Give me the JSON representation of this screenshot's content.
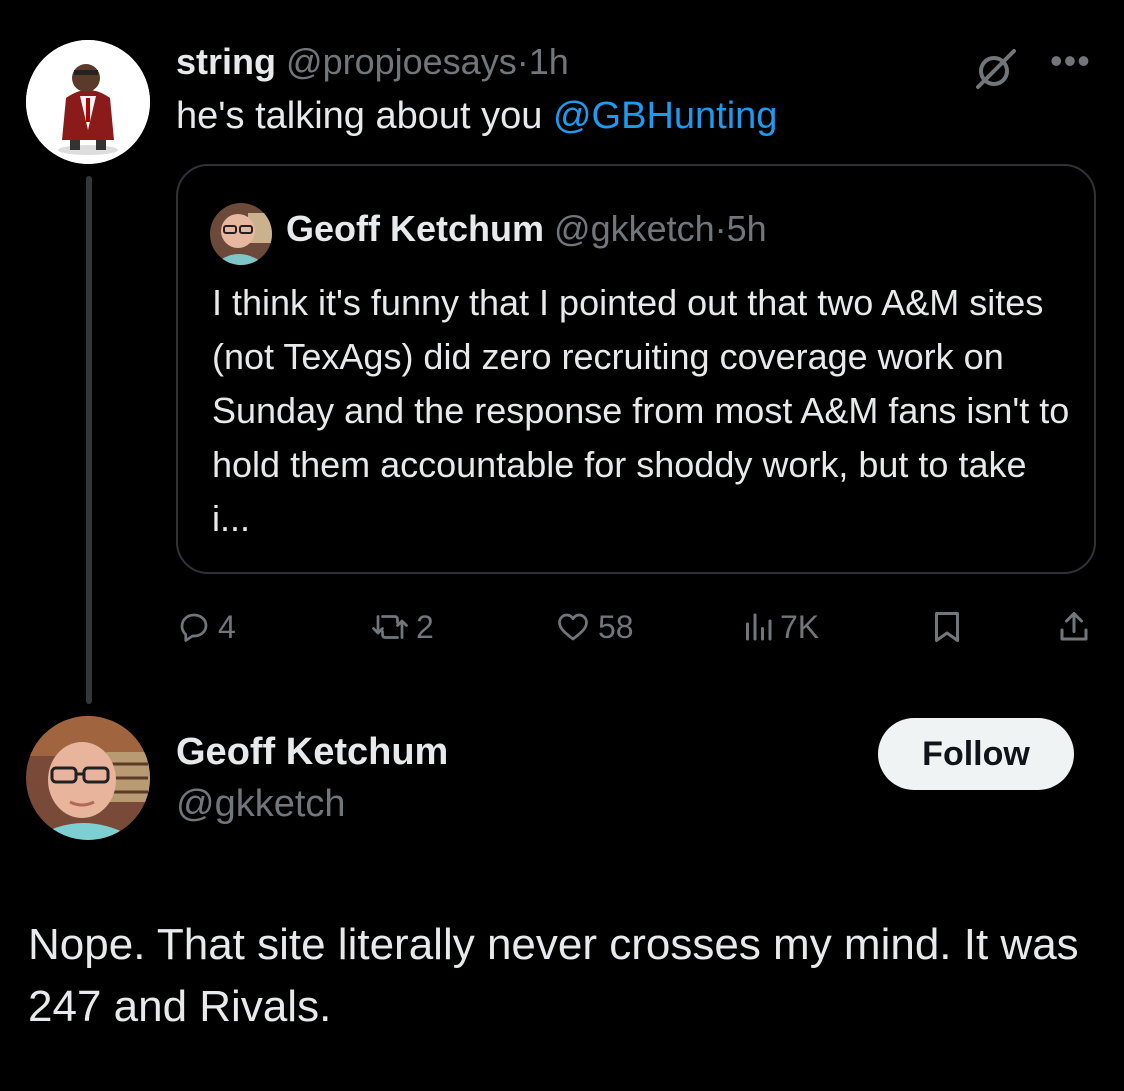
{
  "tweet": {
    "author_name": "string",
    "author_handle": "@propjoesays",
    "time": "1h",
    "text_prefix": "he's talking about you ",
    "mention": "@GBHunting",
    "quote": {
      "author_name": "Geoff Ketchum",
      "author_handle": "@gkketch",
      "time": "5h",
      "text": "I think it's funny that I pointed out that two A&M sites (not TexAgs) did zero recruiting coverage work on Sunday and the response from most A&M fans isn't to hold them accountable for shoddy work, but to take i..."
    },
    "actions": {
      "replies": "4",
      "reposts": "2",
      "likes": "58",
      "views": "7K"
    }
  },
  "reply": {
    "author_name": "Geoff Ketchum",
    "author_handle": "@gkketch",
    "follow_label": "Follow",
    "text": "Nope. That site literally never crosses my mind. It was 247 and Rivals."
  },
  "colors": {
    "background": "#000000",
    "text": "#e7e9ea",
    "secondary": "#71767b",
    "link": "#1d9bf0",
    "border": "#2f3336"
  },
  "separator": "·"
}
